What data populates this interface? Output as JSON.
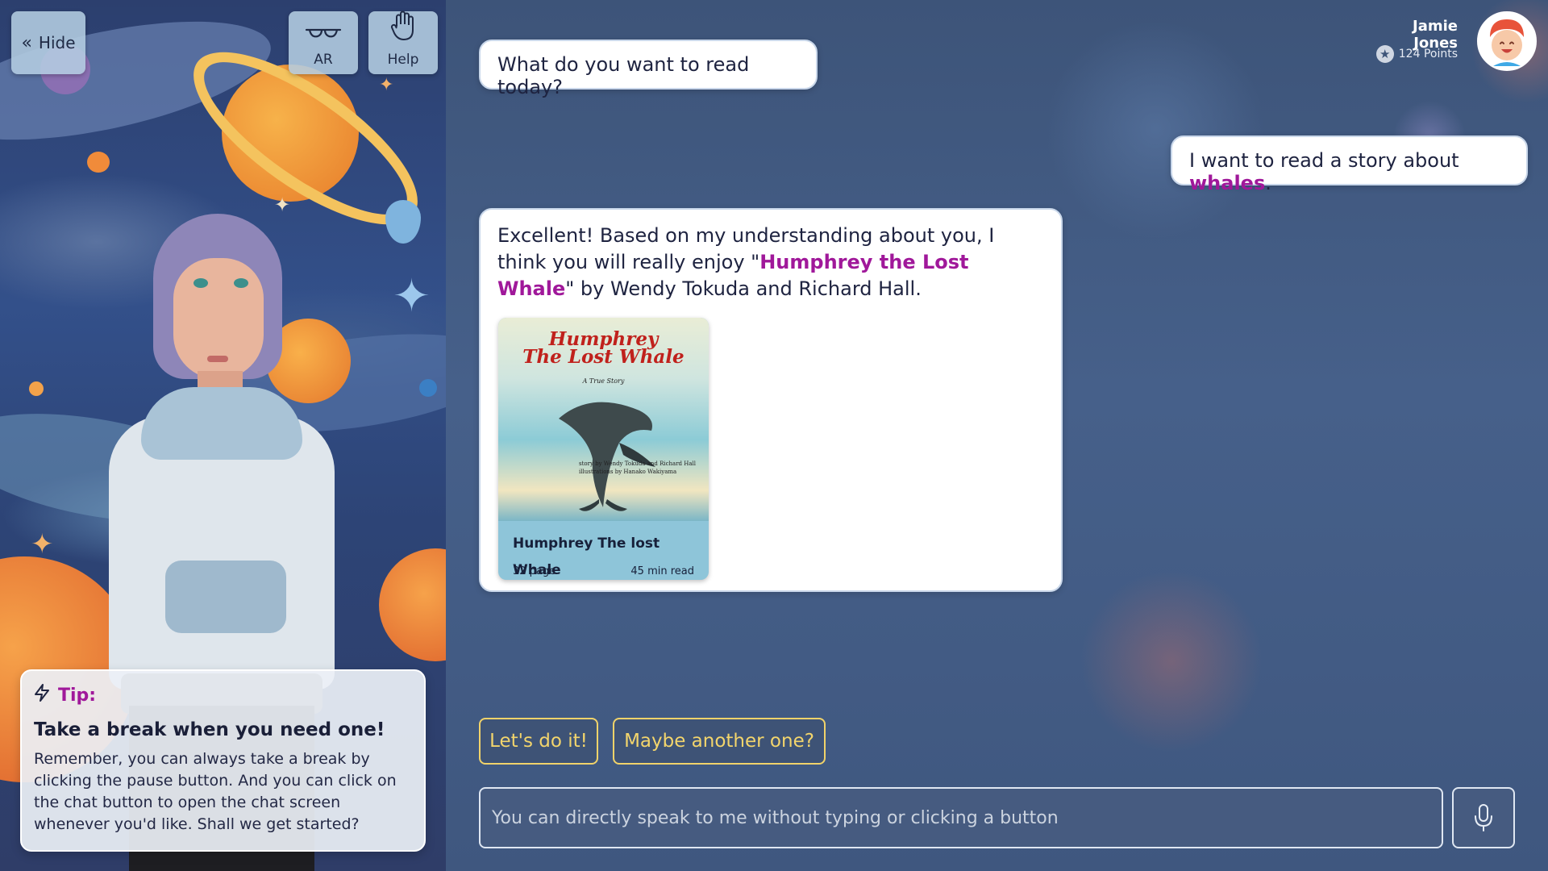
{
  "left_panel": {
    "hide_label": "Hide",
    "hide_icon": "double-chevron-left-icon",
    "ar_label": "AR",
    "ar_icon": "glasses-icon",
    "help_label": "Help",
    "help_icon": "hand-icon"
  },
  "tip": {
    "heading": "Tip:",
    "title": "Take a break when you need one!",
    "body": "Remember, you can always take a break by clicking the pause button. And you can click on the chat button to open the chat screen whenever you'd like. Shall we get started?"
  },
  "profile": {
    "name": "Jamie Jones",
    "points": "124 Points"
  },
  "chat": {
    "assistant_question": "What do you want to read today?",
    "user_message_prefix": "I want to read a story about ",
    "user_message_highlight": "whales",
    "user_message_suffix": ".",
    "reply_part1": "Excellent! Based on my understanding about you, I think you will really enjoy \"",
    "reply_highlight": "Humphrey the Lost Whale",
    "reply_part2": "\" by Wendy Tokuda and Richard Hall.",
    "book": {
      "cover_title_line1": "Humphrey",
      "cover_title_line2": "The Lost Whale",
      "cover_subtitle": "A True Story",
      "cover_credit_line1": "story by Wendy Tokuda and Richard Hall",
      "cover_credit_line2": "illustrations by Hanako Wakiyama",
      "name": "Humphrey The lost Whale",
      "pages": "32 page",
      "read_time": "45 min read"
    },
    "choices": [
      "Let's do it!",
      "Maybe another one?"
    ],
    "input_placeholder": "You can directly speak to me without typing or clicking a button"
  },
  "colors": {
    "accent_magenta": "#a0189a",
    "choice_yellow": "#f3d56c",
    "background_blue": "#3d5479"
  }
}
